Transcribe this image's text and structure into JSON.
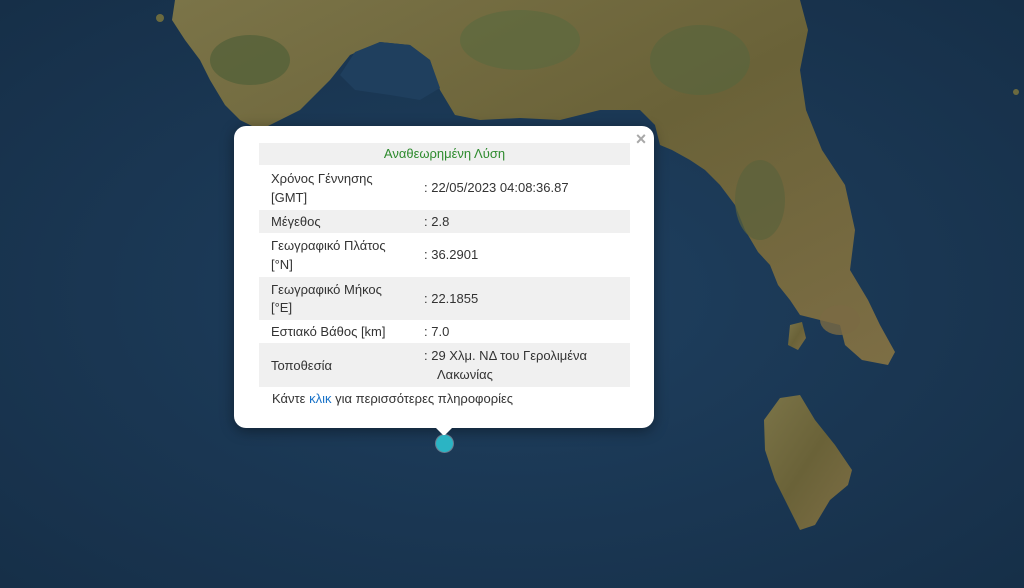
{
  "popup": {
    "header": "Αναθεωρημένη Λύση",
    "close_symbol": "×",
    "rows": [
      {
        "label_line1": "Χρόνος Γέννησης",
        "label_line2": "[GMT]",
        "value": ": 22/05/2023 04:08:36.87"
      },
      {
        "label": "Μέγεθος",
        "value": ": 2.8"
      },
      {
        "label_line1": "Γεωγραφικό Πλάτος",
        "label_line2": "[°N]",
        "value": ": 36.2901"
      },
      {
        "label_line1": "Γεωγραφικό Μήκος",
        "label_line2": "[°E]",
        "value": ": 22.1855"
      },
      {
        "label": "Εστιακό Βάθος [km]",
        "value": ": 7.0"
      },
      {
        "label": "Τοποθεσία",
        "value_line1": ": 29 Χλμ. ΝΔ του Γερολιμένα",
        "value_line2": "Λακωνίας"
      }
    ],
    "more_prefix": "Κάντε ",
    "more_link": "κλικ",
    "more_suffix": " για περισσότερες πληροφορίες"
  },
  "map": {
    "sea_color": "#1c3a57",
    "land_color": "#6b6a3f",
    "marker_color": "#2bb4c4",
    "marker_icon": "earthquake-epicenter-marker"
  }
}
